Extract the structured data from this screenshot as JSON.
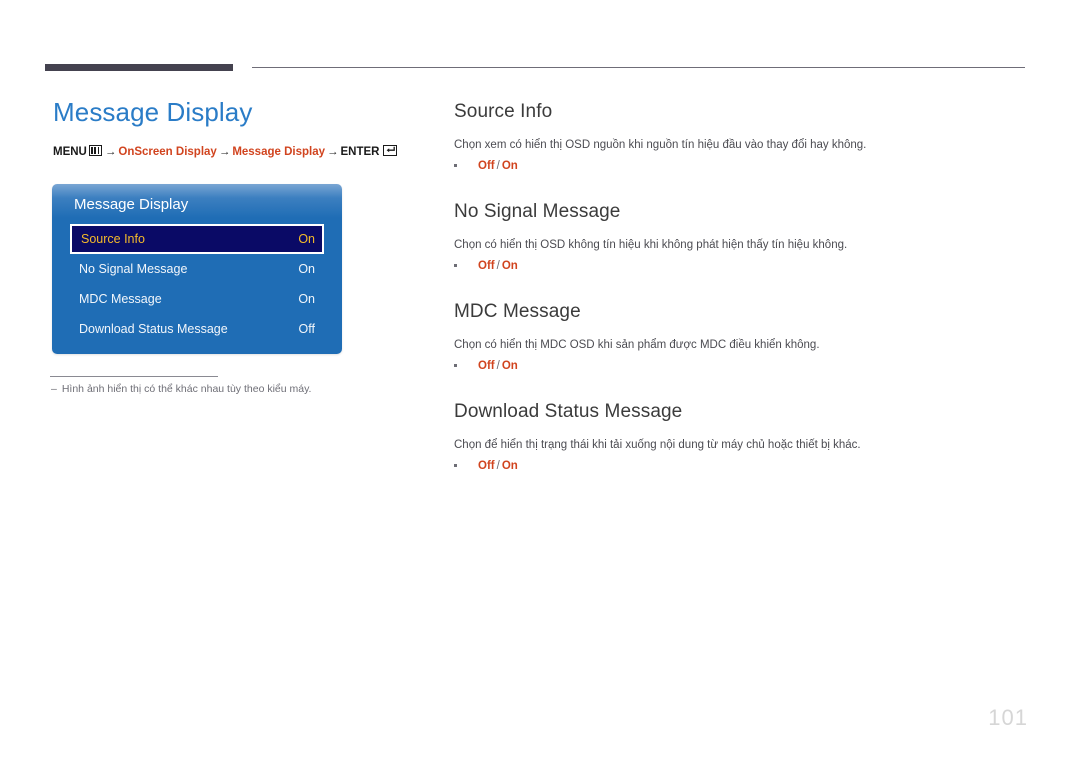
{
  "header": {
    "rule_accent_color": "#44424f",
    "rule_line_color": "#6f6d78"
  },
  "page_title": "Message Display",
  "breadcrumb": {
    "menu_label": "MENU",
    "menu_icon": "menu-bars-icon",
    "arrow": "→",
    "crumb1": "OnScreen Display",
    "crumb2": "Message Display",
    "enter_label": "ENTER",
    "enter_icon": "enter-return-icon",
    "accent_color": "#d1441f"
  },
  "osd": {
    "title": "Message Display",
    "panel_color": "#1f6db5",
    "selected_row_color": "#0a0a66",
    "selected_text_color": "#f5bb2a",
    "rows": [
      {
        "label": "Source Info",
        "value": "On",
        "selected": true
      },
      {
        "label": "No Signal Message",
        "value": "On",
        "selected": false
      },
      {
        "label": "MDC Message",
        "value": "On",
        "selected": false
      },
      {
        "label": "Download Status Message",
        "value": "Off",
        "selected": false
      }
    ]
  },
  "note": {
    "dash": "–",
    "text": "Hình ảnh hiển thị có thể khác nhau tùy theo kiểu máy."
  },
  "sections": [
    {
      "heading": "Source Info",
      "description": "Chọn xem có hiển thị OSD nguồn khi nguồn tín hiệu đầu vào thay đổi hay không.",
      "option_off": "Off",
      "option_sep": "/",
      "option_on": "On"
    },
    {
      "heading": "No Signal Message",
      "description": "Chọn có hiển thị OSD không tín hiệu khi không phát hiện thấy tín hiệu không.",
      "option_off": "Off",
      "option_sep": "/",
      "option_on": "On"
    },
    {
      "heading": "MDC Message",
      "description": "Chọn có hiển thị MDC OSD khi sản phẩm được MDC điều khiển không.",
      "option_off": "Off",
      "option_sep": "/",
      "option_on": "On"
    },
    {
      "heading": "Download Status Message",
      "description": "Chọn để hiển thị trạng thái khi tải xuống nội dung từ máy chủ hoặc thiết bị khác.",
      "option_off": "Off",
      "option_sep": "/",
      "option_on": "On"
    }
  ],
  "page_number": "101"
}
